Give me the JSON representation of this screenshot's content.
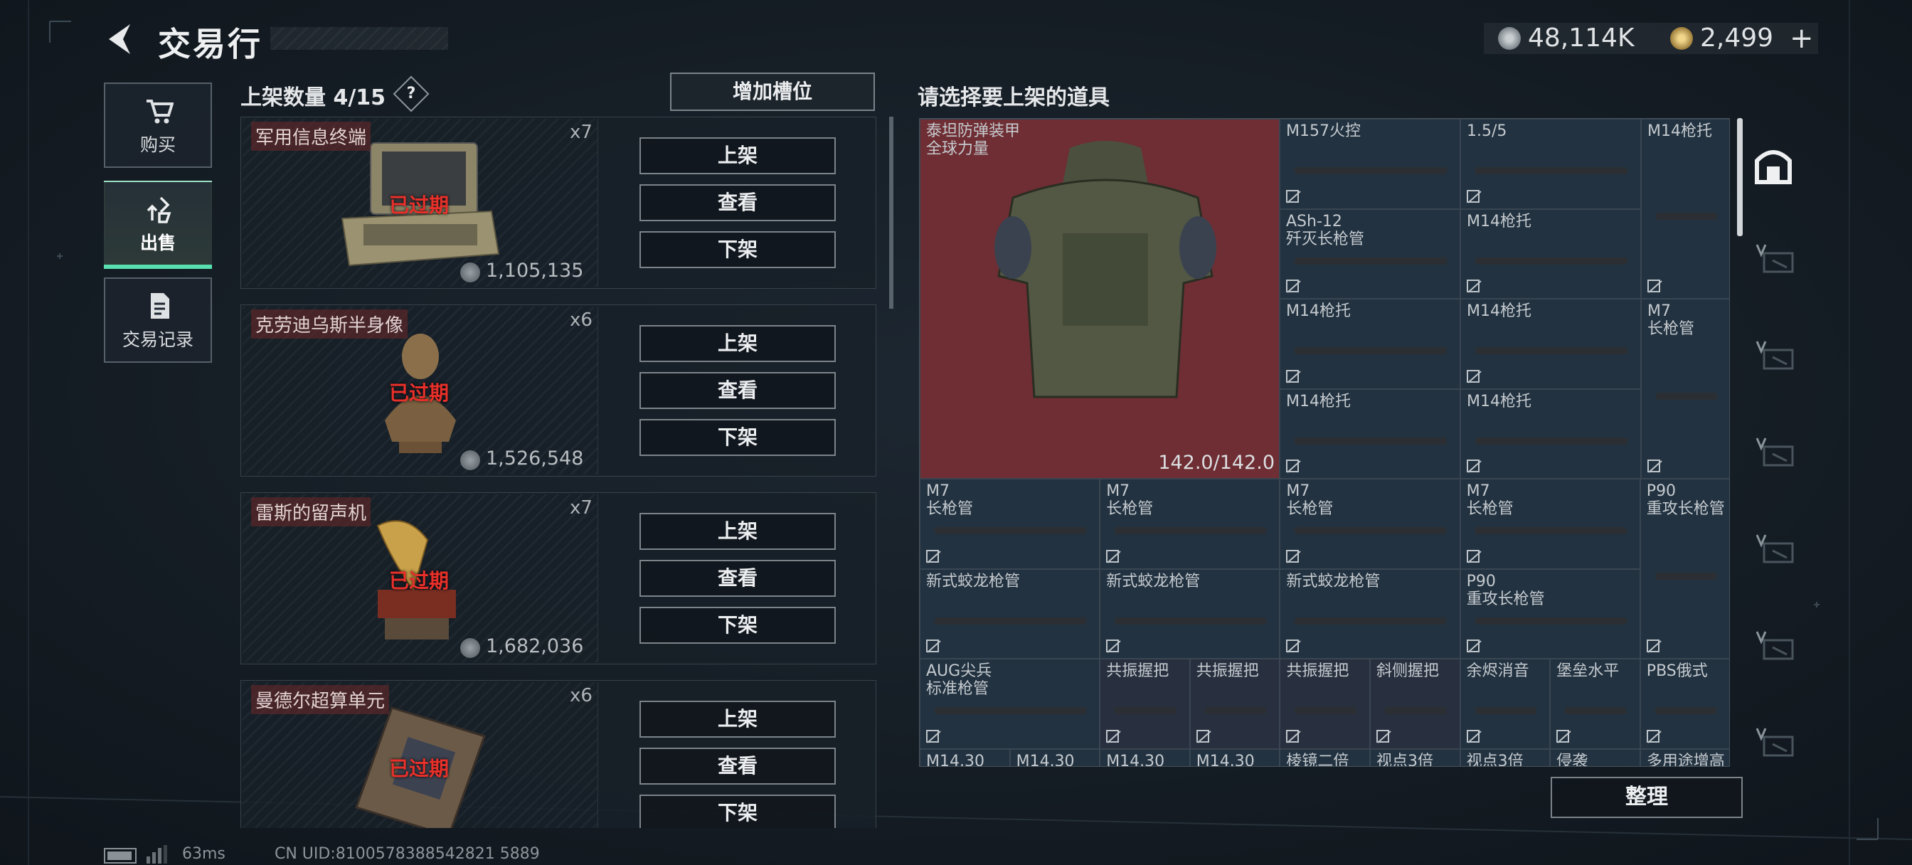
{
  "header": {
    "title": "交易行",
    "back_icon": "chevron-left-icon",
    "currency": [
      {
        "icon": "silver-coin-icon",
        "value": "48,114K"
      },
      {
        "icon": "gold-coin-icon",
        "value": "2,499"
      }
    ],
    "add_currency_symbol": "+"
  },
  "nav": {
    "items": [
      {
        "label": "购买",
        "icon": "cart-icon",
        "active": false
      },
      {
        "label": "出售",
        "icon": "sell-upload-icon",
        "active": true
      },
      {
        "label": "交易记录",
        "icon": "document-icon",
        "active": false
      }
    ]
  },
  "listing": {
    "count_label": "上架数量 4/15",
    "help_symbol": "?",
    "add_slot_label": "增加槽位",
    "actions": {
      "list": "上架",
      "view": "查看",
      "delist": "下架"
    },
    "expired_label": "已过期",
    "items": [
      {
        "name": "军用信息终端",
        "qty": "x7",
        "price": "1,105,135"
      },
      {
        "name": "克劳迪乌斯半身像",
        "qty": "x6",
        "price": "1,526,548"
      },
      {
        "name": "雷斯的留声机",
        "qty": "x7",
        "price": "1,682,036"
      },
      {
        "name": "曼德尔超算单元",
        "qty": "x6",
        "price": ""
      }
    ]
  },
  "inventory": {
    "label": "请选择要上架的道具",
    "tidy_label": "整理",
    "armor": {
      "name_line1": "泰坦防弹装甲",
      "name_line2": "全球力量",
      "durability": "142.0/142.0"
    },
    "cells": [
      {
        "l1": "M157火控",
        "l2": ""
      },
      {
        "l1": "1.5/5",
        "l2": ""
      },
      {
        "l1": "M14枪托",
        "l2": ""
      },
      {
        "l1": "ASh-12",
        "l2": "歼灭长枪管"
      },
      {
        "l1": "M14枪托",
        "l2": ""
      },
      {
        "l1": "M14枪托",
        "l2": ""
      },
      {
        "l1": "M14枪托",
        "l2": ""
      },
      {
        "l1": "M7",
        "l2": "长枪管"
      },
      {
        "l1": "M14枪托",
        "l2": ""
      },
      {
        "l1": "M14枪托",
        "l2": ""
      },
      {
        "l1": "M7",
        "l2": "长枪管"
      },
      {
        "l1": "M7",
        "l2": "长枪管"
      },
      {
        "l1": "M7",
        "l2": "长枪管"
      },
      {
        "l1": "M7",
        "l2": "长枪管"
      },
      {
        "l1": "P90",
        "l2": "重攻长枪管"
      },
      {
        "l1": "新式蛟龙枪管",
        "l2": ""
      },
      {
        "l1": "新式蛟龙枪管",
        "l2": ""
      },
      {
        "l1": "新式蛟龙枪管",
        "l2": ""
      },
      {
        "l1": "P90",
        "l2": "重攻长枪管"
      },
      {
        "l1": "AUG尖兵",
        "l2": "标准枪管"
      },
      {
        "l1": "共振握把",
        "l2": ""
      },
      {
        "l1": "共振握把",
        "l2": ""
      },
      {
        "l1": "共振握把",
        "l2": ""
      },
      {
        "l1": "斜侧握把",
        "l2": ""
      },
      {
        "l1": "余烬消音",
        "l2": ""
      },
      {
        "l1": "堡垒水平",
        "l2": ""
      },
      {
        "l1": "PBS俄式",
        "l2": ""
      },
      {
        "l1": "M14.30",
        "l2": ""
      },
      {
        "l1": "M14.30",
        "l2": ""
      },
      {
        "l1": "M14.30",
        "l2": ""
      },
      {
        "l1": "M14.30",
        "l2": ""
      },
      {
        "l1": "棱镜二倍",
        "l2": ""
      },
      {
        "l1": "视点3倍",
        "l2": ""
      },
      {
        "l1": "视点3倍",
        "l2": ""
      },
      {
        "l1": "侵袭",
        "l2": ""
      },
      {
        "l1": "多用途增高",
        "l2": ""
      }
    ]
  },
  "footer": {
    "ping": "63ms",
    "uid": "CN UID:8100578388542821 5889"
  }
}
